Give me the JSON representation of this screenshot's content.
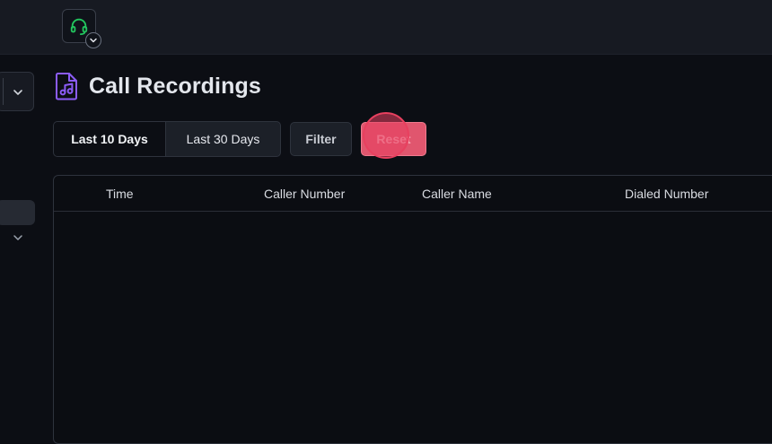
{
  "topbar": {
    "agent_status_icon": "headset-icon",
    "menu_icon": "chevron-down-icon"
  },
  "sidebar": {
    "select_icon": "chevron-down-icon",
    "expand_icon": "chevron-down-icon"
  },
  "page": {
    "icon": "audio-file-icon",
    "title": "Call Recordings"
  },
  "filters": {
    "last_10_days": "Last 10 Days",
    "last_30_days": "Last 30 Days",
    "filter": "Filter",
    "reset": "Reset"
  },
  "table": {
    "columns": [
      "Time",
      "Caller Number",
      "Caller Name",
      "Dialed Number"
    ]
  },
  "colors": {
    "accent": "#8b5cf6",
    "headset": "#22c55e",
    "reset": "#e0566e",
    "background": "#0c0e14"
  }
}
